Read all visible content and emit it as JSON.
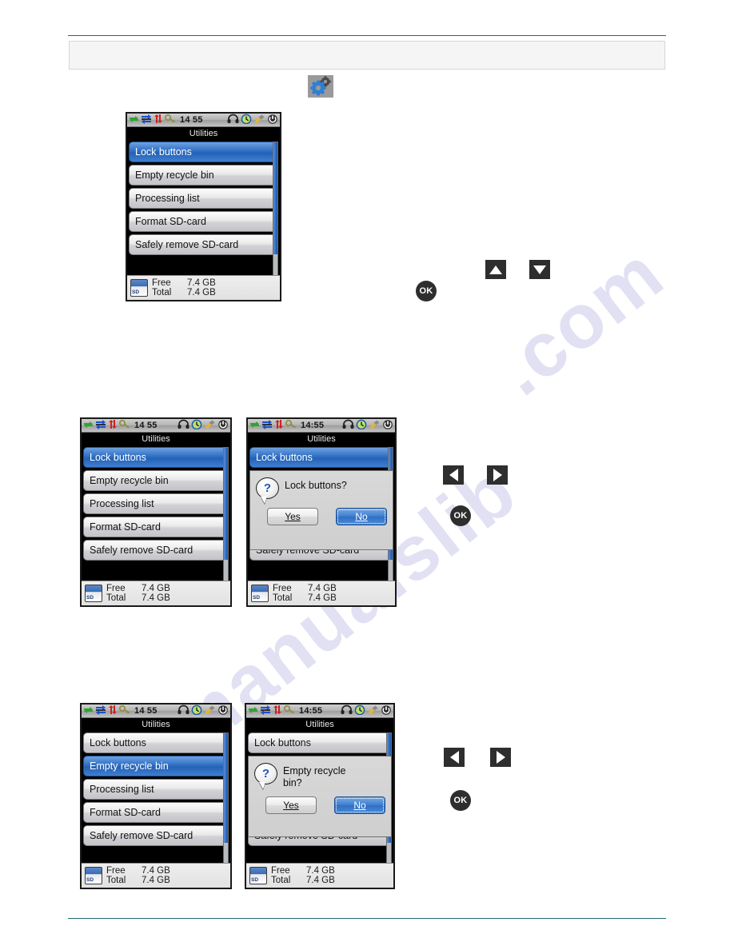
{
  "page": {
    "header_box_text": "",
    "gear_icon": "gears-icon"
  },
  "watermark": {
    "left_text": "manualslib",
    "right_text": ".com"
  },
  "status_bar": {
    "icons": [
      "network-green-arrows-icon",
      "network-blue-arrows-icon",
      "network-red-arrows-icon",
      "key-icon"
    ],
    "right_icons": [
      "headphones-icon",
      "clock-icon",
      "broom-icon",
      "power-icon"
    ],
    "time_nocolon": "14 55",
    "time_colon": "14:55"
  },
  "screen": {
    "title": "Utilities",
    "menu": [
      "Lock buttons",
      "Empty recycle bin",
      "Processing list",
      "Format SD-card",
      "Safely remove SD-card"
    ],
    "sd": {
      "chip_label": "SD",
      "free_label": "Free",
      "free_value": "7.4 GB",
      "total_label": "Total",
      "total_value": "7.4 GB"
    }
  },
  "dialogs": {
    "lock_buttons": {
      "question": "Lock buttons?",
      "yes_label": "Yes",
      "no_label": "No",
      "focused": "No"
    },
    "empty_recycle_bin": {
      "question": "Empty recycle bin?",
      "yes_label": "Yes",
      "no_label": "No",
      "focused": "No"
    }
  },
  "keys": {
    "up": "up-arrow-key",
    "down": "down-arrow-key",
    "left": "left-arrow-key",
    "right": "right-arrow-key",
    "ok": "OK"
  },
  "colors": {
    "accent_blue": "#2f6fc4",
    "rule_teal": "#1f6b72",
    "watermark": "#dcdcf2"
  }
}
